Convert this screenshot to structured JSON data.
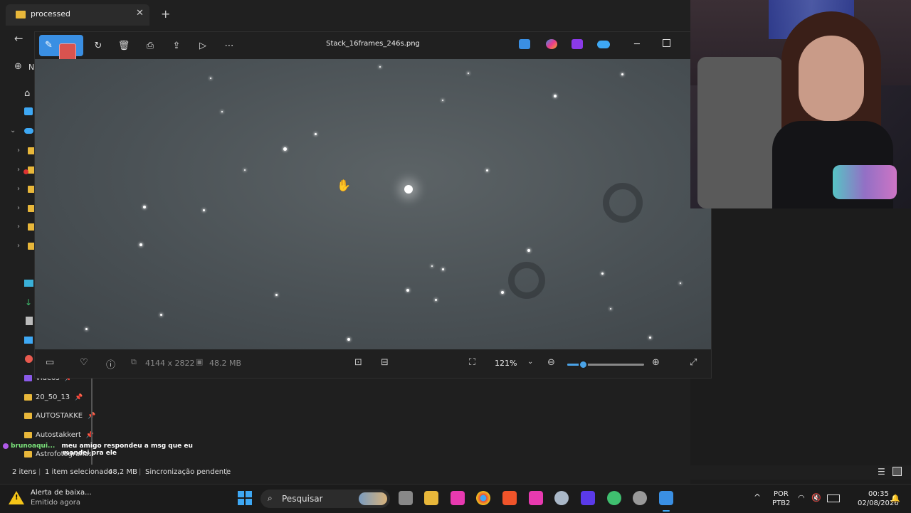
{
  "explorer": {
    "tab_title": "processed",
    "new_button_label": "N",
    "quick_access": [
      {
        "label": "Vídeos"
      },
      {
        "label": "20_50_13"
      },
      {
        "label": "AUTOSTAKKE"
      },
      {
        "label": "Autostakkert"
      },
      {
        "label": "Astrofotografias"
      }
    ],
    "status": {
      "items": "2 itens",
      "selected": "1 item selecionado",
      "size": "48,2 MB",
      "sync": "Sincronização pendente"
    }
  },
  "photos": {
    "filename": "Stack_16frames_246s.png",
    "dimensions": "4144 x 2822",
    "file_size": "48.2 MB",
    "zoom": "121%",
    "zoom_slider_level": 0.2
  },
  "chat": {
    "user": "brunoaqui...",
    "message_line1": "meu amigo respondeu a msg que eu",
    "message_line2": "mandei pra ele"
  },
  "taskbar": {
    "notification_title": "Alerta de baixa...",
    "notification_subtitle": "Emitido agora",
    "search_placeholder": "Pesquisar",
    "language": "POR",
    "keyboard": "PTB2",
    "time": "00:35",
    "date": "02/08/2026"
  },
  "colors": {
    "accent": "#3a8fe3",
    "folder": "#e8b73a",
    "warning": "#f5c518"
  }
}
